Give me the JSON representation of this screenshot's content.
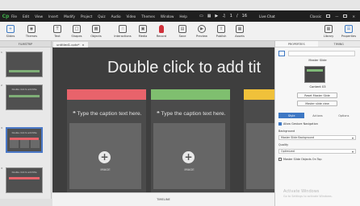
{
  "menubar": {
    "logo": "Cp",
    "items": [
      "File",
      "Edit",
      "View",
      "Insert",
      "Modify",
      "Project",
      "Quiz",
      "Audio",
      "Video",
      "Themes",
      "Window",
      "Help"
    ],
    "page": "1",
    "page_total": "16",
    "live_chat": "Live Chat",
    "mode": "Classic"
  },
  "toolbar": {
    "slides": "Slides",
    "themes": "Themes",
    "text": "Text",
    "shapes": "Shapes",
    "objects": "Objects",
    "interactions": "Interactions",
    "media": "Media",
    "record": "Record",
    "save": "Save",
    "preview": "Preview",
    "publish": "Publish",
    "assets": "Assets",
    "library": "Library",
    "properties": "Properties"
  },
  "filmstrip": {
    "header": "FILMSTRIP",
    "slides": [
      {
        "num": "1",
        "title": ""
      },
      {
        "num": "2",
        "title": "Double click to add title"
      },
      {
        "num": "3",
        "title": "Double click to add title"
      },
      {
        "num": "4",
        "title": "Double click to add title"
      }
    ]
  },
  "document_tab": {
    "name": "untitled1.cptx*",
    "close": "×"
  },
  "stage": {
    "title": "Double click to add tit",
    "caption": "Type the caption text here.",
    "image_label": "IMAGE",
    "columns": [
      {
        "color": "#e8636b"
      },
      {
        "color": "#7fbf6f"
      },
      {
        "color": "#f0c13a"
      }
    ]
  },
  "timeline": {
    "label": "TIMELINE"
  },
  "panel": {
    "tab_properties": "PROPERTIES",
    "tab_timing": "TIMING",
    "master_slide": "Master Slide",
    "content": "Content 03",
    "reset_button": "Reset Master Slide",
    "master_view_button": "Master slide view",
    "sub_tabs": [
      "Style",
      "Actions",
      "Options"
    ],
    "allow_gesture": "Allow Gesture Navigation",
    "background_label": "Background",
    "background_value": "Master Slide Background",
    "quality_label": "Quality",
    "quality_value": "Optimized",
    "objects_on_top": "Master Slide Objects On Top",
    "watermark_line1": "Activate Windows",
    "watermark_line2": "Go to Settings to activate Windows."
  }
}
